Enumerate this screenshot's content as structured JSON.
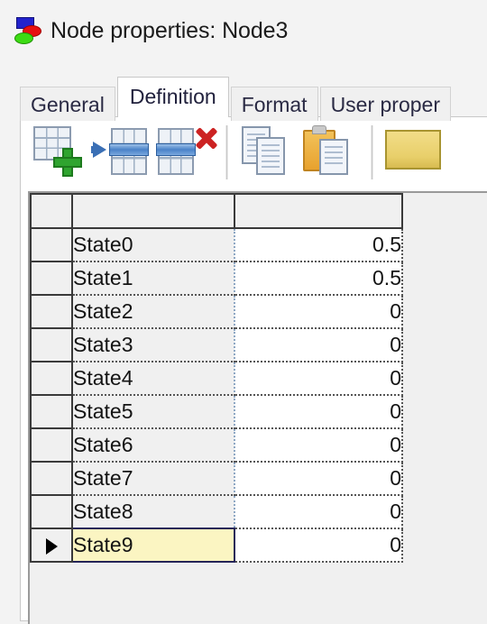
{
  "window": {
    "title": "Node properties: Node3",
    "icon": "node-properties-icon"
  },
  "tabs": [
    {
      "label": "General",
      "active": false,
      "name": "tab-general"
    },
    {
      "label": "Definition",
      "active": true,
      "name": "tab-definition"
    },
    {
      "label": "Format",
      "active": false,
      "name": "tab-format"
    },
    {
      "label": "User proper",
      "active": false,
      "name": "tab-user-properties"
    }
  ],
  "toolbar": {
    "buttons": [
      {
        "name": "add-table-button",
        "icon": "table-add-icon",
        "title": "Add table"
      },
      {
        "name": "insert-row-button",
        "icon": "row-insert-icon",
        "title": "Insert row"
      },
      {
        "name": "delete-row-button",
        "icon": "row-delete-icon",
        "title": "Delete row"
      },
      {
        "name": "copy-button",
        "icon": "copy-icon",
        "title": "Copy"
      },
      {
        "name": "paste-button",
        "icon": "paste-icon",
        "title": "Paste"
      },
      {
        "name": "note-button",
        "icon": "note-icon",
        "title": "Note"
      }
    ]
  },
  "grid": {
    "headers": [
      "",
      "",
      ""
    ],
    "rows": [
      {
        "selector": "",
        "state": "State0",
        "value": "0.5",
        "selected": false
      },
      {
        "selector": "",
        "state": "State1",
        "value": "0.5",
        "selected": false
      },
      {
        "selector": "",
        "state": "State2",
        "value": "0",
        "selected": false
      },
      {
        "selector": "",
        "state": "State3",
        "value": "0",
        "selected": false
      },
      {
        "selector": "",
        "state": "State4",
        "value": "0",
        "selected": false
      },
      {
        "selector": "",
        "state": "State5",
        "value": "0",
        "selected": false
      },
      {
        "selector": "",
        "state": "State6",
        "value": "0",
        "selected": false
      },
      {
        "selector": "",
        "state": "State7",
        "value": "0",
        "selected": false
      },
      {
        "selector": "",
        "state": "State8",
        "value": "0",
        "selected": false
      },
      {
        "selector": "▶",
        "state": "State9",
        "value": "0",
        "selected": true
      }
    ]
  },
  "colors": {
    "page_background": "#f3f3f3",
    "pane_background": "#ffffff",
    "grid_background": "#f0f0f0",
    "selected_row_fill": "#fbf5c2",
    "selected_row_border": "#242458",
    "icon_blue": "#2222cc",
    "icon_red": "#e61111",
    "icon_green": "#3ddb13",
    "accent_gold": "#e8cf6a"
  }
}
